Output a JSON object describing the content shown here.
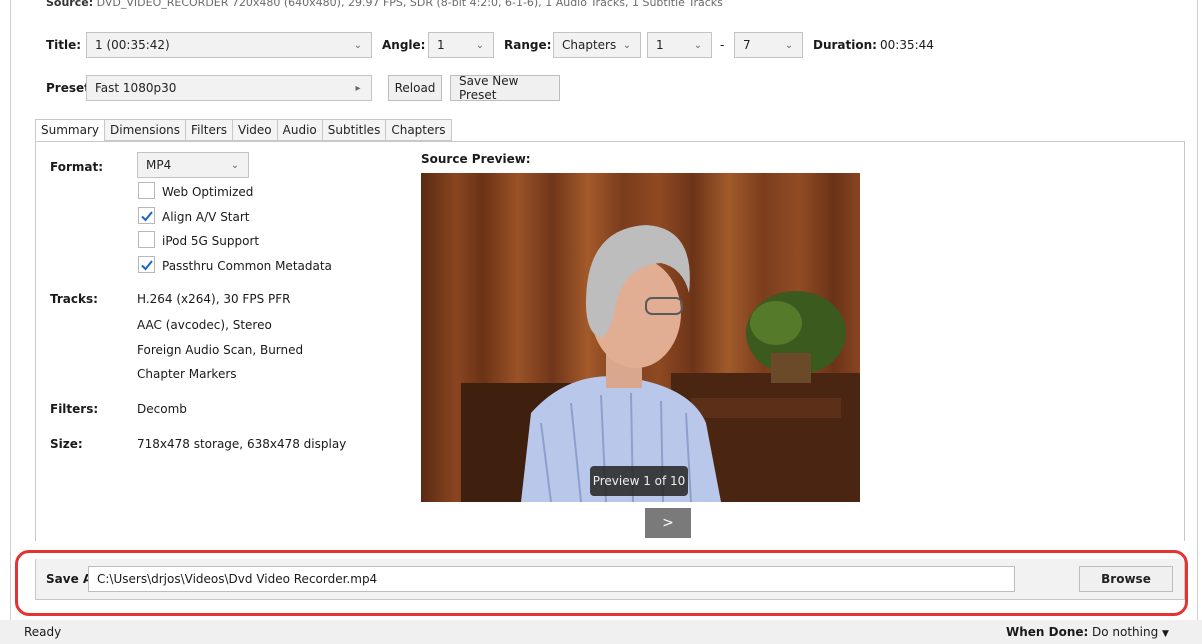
{
  "source": {
    "label": "Source:",
    "value": "DVD_VIDEO_RECORDER  720x480 (640x480), 29.97 FPS, SDR (8-bit 4:2:0, 6-1-6), 1 Audio Tracks, 1 Subtitle Tracks"
  },
  "title": {
    "label": "Title:",
    "value": "1 (00:35:42)"
  },
  "angle": {
    "label": "Angle:",
    "value": "1"
  },
  "range": {
    "label": "Range:",
    "mode": "Chapters",
    "start": "1",
    "separator": "-",
    "end": "7"
  },
  "duration": {
    "label": "Duration:",
    "value": "00:35:44"
  },
  "preset": {
    "label": "Preset:",
    "value": "Fast 1080p30",
    "reload_label": "Reload",
    "save_new_label": "Save New Preset"
  },
  "tabs": [
    {
      "label": "Summary",
      "active": true
    },
    {
      "label": "Dimensions"
    },
    {
      "label": "Filters"
    },
    {
      "label": "Video"
    },
    {
      "label": "Audio"
    },
    {
      "label": "Subtitles"
    },
    {
      "label": "Chapters"
    }
  ],
  "summary": {
    "format_label": "Format:",
    "format_value": "MP4",
    "checkboxes": [
      {
        "label": "Web Optimized",
        "checked": false
      },
      {
        "label": "Align A/V Start",
        "checked": true
      },
      {
        "label": "iPod 5G Support",
        "checked": false
      },
      {
        "label": "Passthru Common Metadata",
        "checked": true
      }
    ],
    "tracks_label": "Tracks:",
    "tracks": [
      "H.264 (x264), 30 FPS PFR",
      "AAC (avcodec), Stereo",
      "Foreign Audio Scan, Burned",
      "Chapter Markers"
    ],
    "filters_label": "Filters:",
    "filters_value": "Decomb",
    "size_label": "Size:",
    "size_value": "718x478 storage, 638x478 display"
  },
  "preview": {
    "label": "Source Preview:",
    "counter": "Preview 1 of 10",
    "next_label": ">"
  },
  "save_as": {
    "label": "Save As:",
    "path": "C:\\Users\\drjos\\Videos\\Dvd Video Recorder.mp4",
    "browse_label": "Browse"
  },
  "status": {
    "text": "Ready",
    "when_done_label": "When Done:",
    "when_done_value": "Do nothing"
  },
  "colors": {
    "highlight": "#e53333",
    "check": "#1e63c9"
  }
}
